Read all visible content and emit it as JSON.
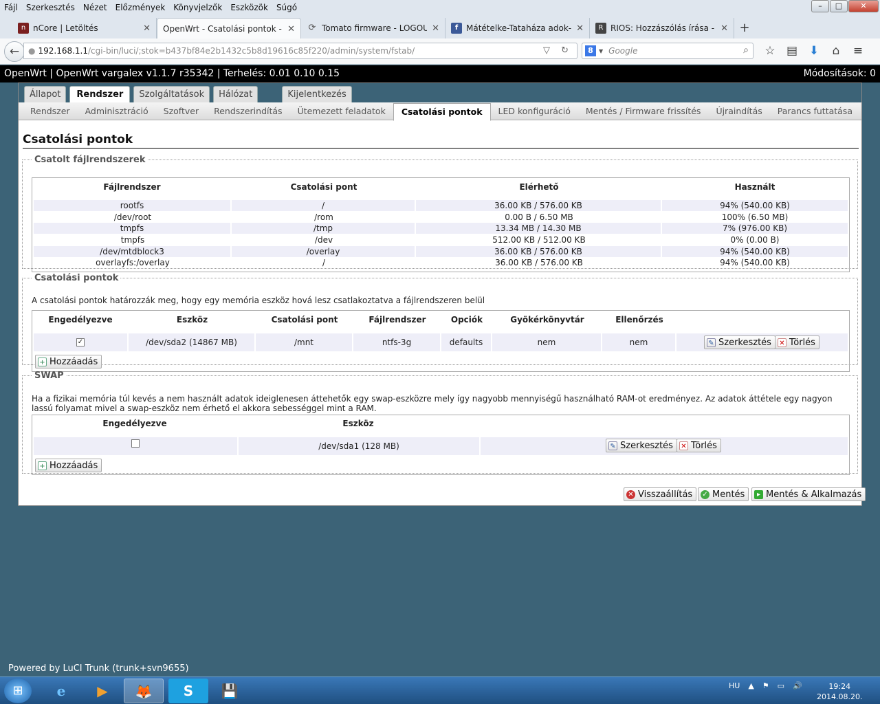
{
  "menubar": {
    "items": [
      "Fájl",
      "Szerkesztés",
      "Nézet",
      "Előzmények",
      "Könyvjelzők",
      "Eszközök",
      "Súgó"
    ]
  },
  "window": {
    "minimize": "–",
    "maximize": "□",
    "close": "✕"
  },
  "browser_tabs": [
    {
      "title": "nCore | Letöltés",
      "icon": "ncore-icon",
      "icon_color": "#7a1f1f"
    },
    {
      "title": "OpenWrt - Csatolási pontok - L...",
      "icon": "openwrt-icon",
      "icon_color": "#f0f0f0"
    },
    {
      "title": "Tomato firmware - LOGOU...",
      "icon": "chat-icon",
      "icon_color": "#888888"
    },
    {
      "title": "Mátételke-Tataháza adok-...",
      "icon": "facebook-icon",
      "icon_color": "#3b5998"
    },
    {
      "title": "RIOS: Hozzászólás írása - T...",
      "icon": "rios-icon",
      "icon_color": "#444444"
    }
  ],
  "tab_close": "✕",
  "newtab": "+",
  "nav": {
    "back": "←",
    "url_host": "192.168.1.1",
    "url_path": "/cgi-bin/luci/;stok=b437bf84e2b1432c5b8d19616c85f220/admin/system/fstab/",
    "url_icons": "▽ ↻",
    "search_placeholder": "Google",
    "search_engine": "8",
    "search_icon": "⌕",
    "toolbar_icons": [
      "☆",
      "▤",
      "⬇",
      "⌂",
      "≡"
    ]
  },
  "owheader": {
    "left": "OpenWrt | OpenWrt vargalex v1.1.7 r35342 | Terhelés: 0.01 0.10 0.15",
    "right": "Módosítások: 0"
  },
  "maintabs": [
    "Állapot",
    "Rendszer",
    "Szolgáltatások",
    "Hálózat",
    "Kijelentkezés"
  ],
  "subtabs": [
    "Rendszer",
    "Adminisztráció",
    "Szoftver",
    "Rendszerindítás",
    "Ütemezett feladatok",
    "Csatolási pontok",
    "LED konfiguráció",
    "Mentés / Firmware frissítés",
    "Újraindítás",
    "Parancs futtatása"
  ],
  "page_title": "Csatolási pontok",
  "mounted": {
    "legend": "Csatolt fájlrendszerek",
    "headers": [
      "Fájlrendszer",
      "Csatolási pont",
      "Elérhető",
      "Használt"
    ],
    "rows": [
      [
        "rootfs",
        "/",
        "36.00 KB / 576.00 KB",
        "94% (540.00 KB)"
      ],
      [
        "/dev/root",
        "/rom",
        "0.00 B / 6.50 MB",
        "100% (6.50 MB)"
      ],
      [
        "tmpfs",
        "/tmp",
        "13.34 MB / 14.30 MB",
        "7% (976.00 KB)"
      ],
      [
        "tmpfs",
        "/dev",
        "512.00 KB / 512.00 KB",
        "0% (0.00 B)"
      ],
      [
        "/dev/mtdblock3",
        "/overlay",
        "36.00 KB / 576.00 KB",
        "94% (540.00 KB)"
      ],
      [
        "overlayfs:/overlay",
        "/",
        "36.00 KB / 576.00 KB",
        "94% (540.00 KB)"
      ]
    ]
  },
  "mounts": {
    "legend": "Csatolási pontok",
    "description": "A csatolási pontok határozzák meg, hogy egy memória eszköz hová lesz csatlakoztatva a fájlrendszeren belül",
    "headers": [
      "Engedélyezve",
      "Eszköz",
      "Csatolási pont",
      "Fájlrendszer",
      "Opciók",
      "Gyökérkönyvtár",
      "Ellenőrzés"
    ],
    "row": {
      "enabled": true,
      "device": "/dev/sda2 (14867 MB)",
      "mountpoint": "/mnt",
      "fs": "ntfs-3g",
      "options": "defaults",
      "root": "nem",
      "check": "nem"
    },
    "edit": "Szerkesztés",
    "delete": "Törlés",
    "add": "Hozzáadás"
  },
  "swap": {
    "legend": "SWAP",
    "description": "Ha a fizikai memória túl kevés a nem használt adatok ideiglenesen áttehetők egy swap-eszközre mely így nagyobb mennyiségű használható RAM-ot eredményez. Az adatok áttétele egy nagyon lassú folyamat mivel a swap-eszköz nem érhető el akkora sebességgel mint a RAM.",
    "headers": [
      "Engedélyezve",
      "Eszköz"
    ],
    "row": {
      "enabled": false,
      "device": "/dev/sda1 (128 MB)"
    },
    "edit": "Szerkesztés",
    "delete": "Törlés",
    "add": "Hozzáadás"
  },
  "actions": {
    "reset": "Visszaállítás",
    "save": "Mentés",
    "apply": "Mentés & Alkalmazás"
  },
  "footer": "Powered by LuCI Trunk (trunk+svn9655)",
  "taskbar": {
    "apps": [
      "e",
      "▶",
      "🦊",
      "S",
      "💾"
    ],
    "lang": "HU",
    "tray_icons": [
      "▲",
      "⚑",
      "▭",
      "🔊"
    ],
    "time": "19:24",
    "date": "2014.08.20.",
    "start": "⊞"
  }
}
